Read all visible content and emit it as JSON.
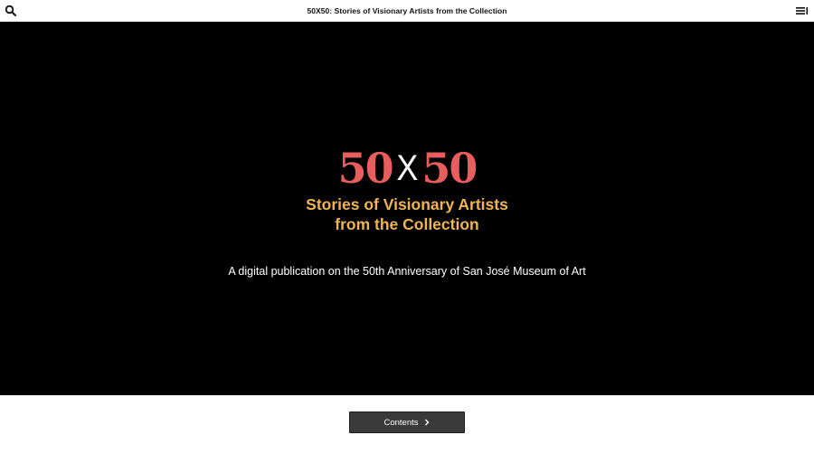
{
  "header": {
    "title": "50X50: Stories of Visionary Artists from the Collection",
    "search_icon": "search-icon",
    "menu_icon": "menu-icon"
  },
  "hero": {
    "logo": {
      "left": "50",
      "x": "X",
      "right": "50"
    },
    "subtitle_line1": "Stories of Visionary Artists",
    "subtitle_line2": "from the Collection",
    "description": "A digital publication on the 50th Anniversary of San José Museum of Art"
  },
  "footer": {
    "contents_label": "Contents",
    "contents_icon": "chevron-right-icon"
  },
  "colors": {
    "logo_red": "#e85d5d",
    "subtitle_gold": "#f0b552",
    "hero_background": "#000000",
    "button_background": "#3a3a3a"
  }
}
